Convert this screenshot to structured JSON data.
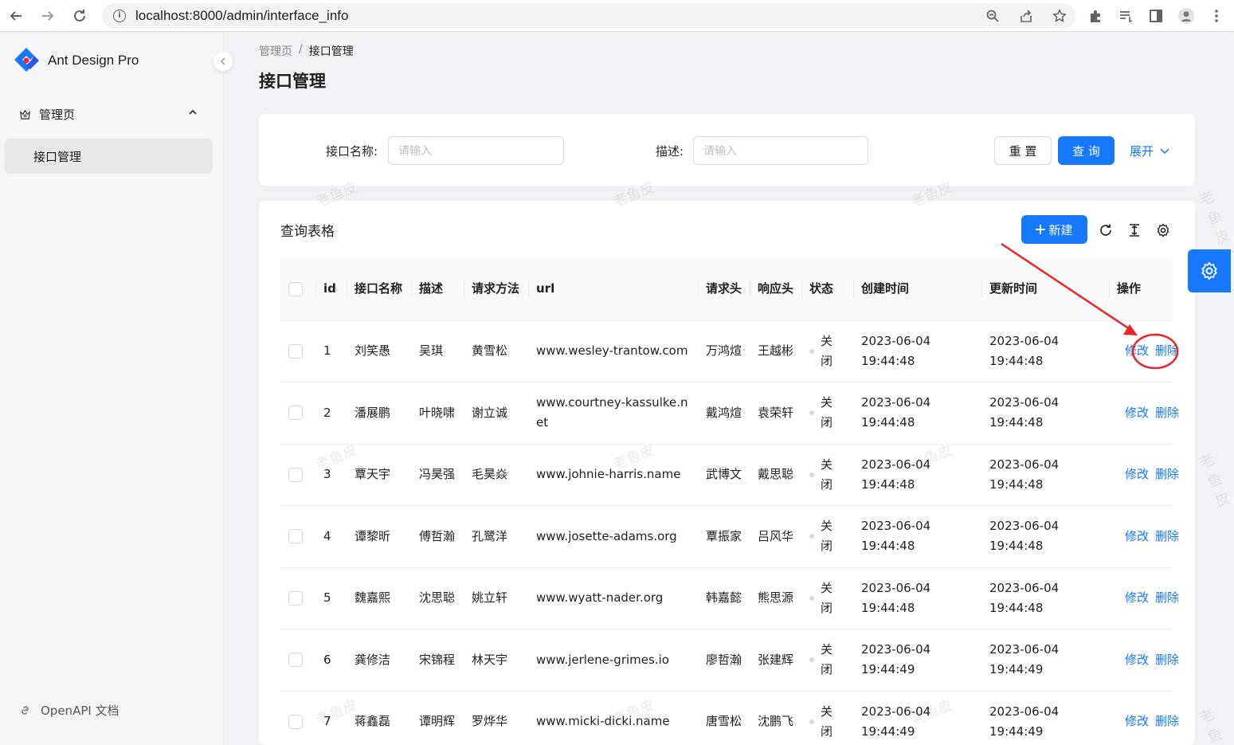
{
  "browser": {
    "url": "localhost:8000/admin/interface_info"
  },
  "sidebar": {
    "app_title": "Ant Design Pro",
    "group_label": "管理页",
    "active_item": "接口管理",
    "footer_link": "OpenAPI 文档"
  },
  "header": {
    "breadcrumb": [
      "管理页",
      "接口管理"
    ],
    "breadcrumb_sep": "/",
    "title": "接口管理"
  },
  "search": {
    "name_label": "接口名称:",
    "name_placeholder": "请输入",
    "desc_label": "描述:",
    "desc_placeholder": "请输入",
    "reset_label": "重 置",
    "query_label": "查 询",
    "expand_label": "展开"
  },
  "table": {
    "title": "查询表格",
    "new_label": "新建",
    "columns": [
      "id",
      "接口名称",
      "描述",
      "请求方法",
      "url",
      "请求头",
      "响应头",
      "状态",
      "创建时间",
      "更新时间",
      "操作"
    ],
    "rows": [
      {
        "id": "1",
        "name": "刘笑愚",
        "desc": "吴琪",
        "method": "黄雪松",
        "url": "www.wesley-trantow.com",
        "req": "万鸿煊",
        "res": "王越彬",
        "status": "关闭",
        "created_date": "2023-06-04",
        "created_time": "19:44:48",
        "updated_date": "2023-06-04",
        "updated_time": "19:44:48"
      },
      {
        "id": "2",
        "name": "潘展鹏",
        "desc": "叶晓啸",
        "method": "谢立诚",
        "url": "www.courtney-kassulke.net",
        "req": "戴鸿煊",
        "res": "袁荣轩",
        "status": "关闭",
        "created_date": "2023-06-04",
        "created_time": "19:44:48",
        "updated_date": "2023-06-04",
        "updated_time": "19:44:48"
      },
      {
        "id": "3",
        "name": "覃天宇",
        "desc": "冯昊强",
        "method": "毛昊焱",
        "url": "www.johnie-harris.name",
        "req": "武博文",
        "res": "戴思聪",
        "status": "关闭",
        "created_date": "2023-06-04",
        "created_time": "19:44:48",
        "updated_date": "2023-06-04",
        "updated_time": "19:44:48"
      },
      {
        "id": "4",
        "name": "谭黎昕",
        "desc": "傅哲瀚",
        "method": "孔鹭洋",
        "url": "www.josette-adams.org",
        "req": "覃振家",
        "res": "吕风华",
        "status": "关闭",
        "created_date": "2023-06-04",
        "created_time": "19:44:48",
        "updated_date": "2023-06-04",
        "updated_time": "19:44:48"
      },
      {
        "id": "5",
        "name": "魏嘉熙",
        "desc": "沈思聪",
        "method": "姚立轩",
        "url": "www.wyatt-nader.org",
        "req": "韩嘉懿",
        "res": "熊思源",
        "status": "关闭",
        "created_date": "2023-06-04",
        "created_time": "19:44:48",
        "updated_date": "2023-06-04",
        "updated_time": "19:44:48"
      },
      {
        "id": "6",
        "name": "龚修洁",
        "desc": "宋锦程",
        "method": "林天宇",
        "url": "www.jerlene-grimes.io",
        "req": "廖哲瀚",
        "res": "张建辉",
        "status": "关闭",
        "created_date": "2023-06-04",
        "created_time": "19:44:49",
        "updated_date": "2023-06-04",
        "updated_time": "19:44:49"
      },
      {
        "id": "7",
        "name": "蒋鑫磊",
        "desc": "谭明辉",
        "method": "罗烨华",
        "url": "www.micki-dicki.name",
        "req": "唐雪松",
        "res": "沈鹏飞",
        "status": "关闭",
        "created_date": "2023-06-04",
        "created_time": "19:44:49",
        "updated_date": "2023-06-04",
        "updated_time": "19:44:49"
      }
    ],
    "edit_label": "修改",
    "delete_label": "删除"
  },
  "watermark_text": "老鱼皮",
  "colors": {
    "primary": "#1677ff",
    "annotation": "#e8262a"
  }
}
